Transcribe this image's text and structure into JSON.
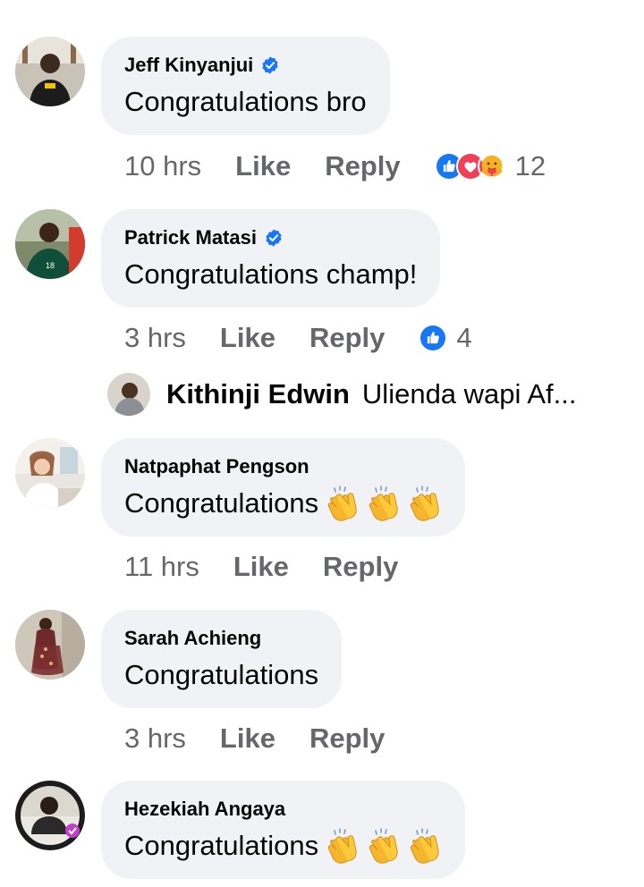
{
  "comments": [
    {
      "author": "Jeff Kinyanjui",
      "verified": true,
      "text": "Congratulations bro",
      "time": "10 hrs",
      "like_label": "Like",
      "reply_label": "Reply",
      "reaction_icons": [
        "like",
        "love",
        "care"
      ],
      "reaction_count": "12"
    },
    {
      "author": "Patrick Matasi",
      "verified": true,
      "text": "Congratulations champ!",
      "time": "3 hrs",
      "like_label": "Like",
      "reply_label": "Reply",
      "reaction_icons": [
        "like"
      ],
      "reaction_count": "4",
      "reply_preview": {
        "author": "Kithinji Edwin",
        "text": "Ulienda wapi Af..."
      }
    },
    {
      "author": "Natpaphat Pengson",
      "verified": false,
      "text": "Congratulations",
      "emoji": [
        "clapping-hands",
        "clapping-hands",
        "clapping-hands"
      ],
      "time": "11 hrs",
      "like_label": "Like",
      "reply_label": "Reply"
    },
    {
      "author": "Sarah Achieng",
      "verified": false,
      "text": "Congratulations",
      "time": "3 hrs",
      "like_label": "Like",
      "reply_label": "Reply"
    },
    {
      "author": "Hezekiah Angaya",
      "verified": false,
      "text": "Congratulations",
      "emoji": [
        "clapping-hands",
        "clapping-hands",
        "clapping-hands"
      ]
    }
  ],
  "colors": {
    "bubble": "#f0f2f5",
    "meta_text": "#65676b",
    "verified_blue": "#1877f2",
    "like_blue": "#1877f2",
    "love_red": "#f33e58",
    "care_yellow": "#f7b125"
  }
}
